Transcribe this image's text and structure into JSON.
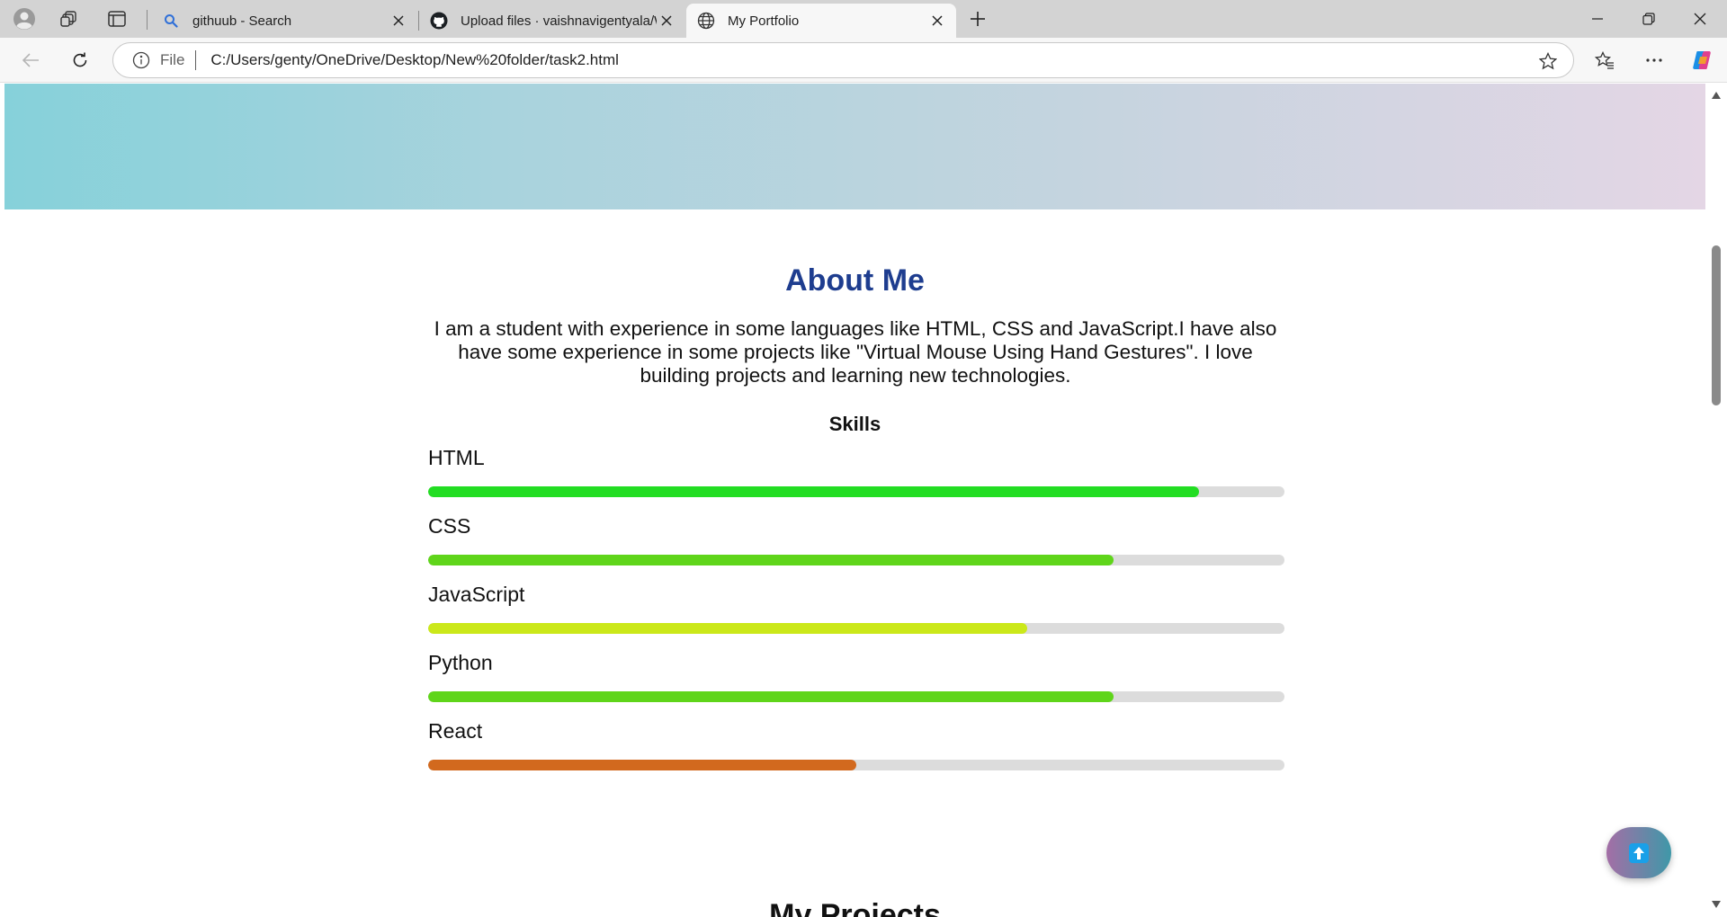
{
  "browser": {
    "tabs": [
      {
        "title": "githuub - Search",
        "favicon": "search-icon"
      },
      {
        "title": "Upload files · vaishnavigentyala/W",
        "favicon": "github-icon"
      },
      {
        "title": "My Portfolio",
        "favicon": "globe-icon",
        "active": true
      }
    ],
    "address": {
      "scheme_label": "File",
      "url": "C:/Users/genty/OneDrive/Desktop/New%20folder/task2.html"
    }
  },
  "page": {
    "about": {
      "title": "About Me",
      "text": "I am a student with experience in some languages like HTML, CSS and JavaScript.I have also have some experience in some projects like \"Virtual Mouse Using Hand Gestures\". I love building projects and learning new technologies."
    },
    "skills": {
      "title": "Skills",
      "items": [
        {
          "name": "HTML",
          "level": 0.9,
          "color": "#22dd22"
        },
        {
          "name": "CSS",
          "level": 0.8,
          "color": "#5fd51a"
        },
        {
          "name": "JavaScript",
          "level": 0.7,
          "color": "#cbe81a"
        },
        {
          "name": "Python",
          "level": 0.8,
          "color": "#5fd51a"
        },
        {
          "name": "React",
          "level": 0.5,
          "color": "#d2691e"
        }
      ]
    },
    "projects": {
      "title": "My Projects"
    }
  },
  "colors": {
    "accent_title": "#1e3d8f",
    "track": "#dcdcdc",
    "hero_gradient_start": "#86d1da",
    "hero_gradient_end": "#e4d6e5"
  }
}
